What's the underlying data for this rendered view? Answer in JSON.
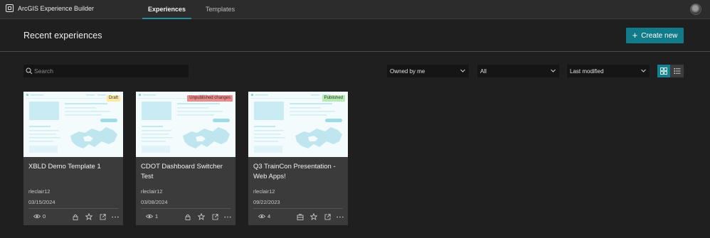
{
  "header": {
    "app_name": "ArcGIS Experience Builder",
    "tabs": [
      {
        "label": "Experiences",
        "active": true
      },
      {
        "label": "Templates",
        "active": false
      }
    ]
  },
  "page": {
    "title": "Recent experiences",
    "create_button": "Create new"
  },
  "filters": {
    "search_placeholder": "Search",
    "owner": "Owned by me",
    "type": "All",
    "sort": "Last modified",
    "view": "grid"
  },
  "colors": {
    "accent": "#117b8a",
    "badge_draft": "#fbe9a4",
    "badge_unpublished": "#ed8a8a",
    "badge_published": "#b6ecb0"
  },
  "cards": [
    {
      "title": "XBLD Demo Template 1",
      "status": "Draft",
      "owner": "rleclair12",
      "date": "03/15/2024",
      "views": "0"
    },
    {
      "title": "CDOT Dashboard Switcher Test",
      "status": "Unpublished changes",
      "owner": "rleclair12",
      "date": "03/08/2024",
      "views": "1"
    },
    {
      "title": "Q3 TrainCon Presentation - Web Apps!",
      "status": "Published",
      "owner": "rleclair12",
      "date": "09/22/2023",
      "views": "4"
    }
  ],
  "card_icons": [
    "eye-icon",
    "lock-icon",
    "star-icon",
    "open-external-icon",
    "more-icon"
  ]
}
